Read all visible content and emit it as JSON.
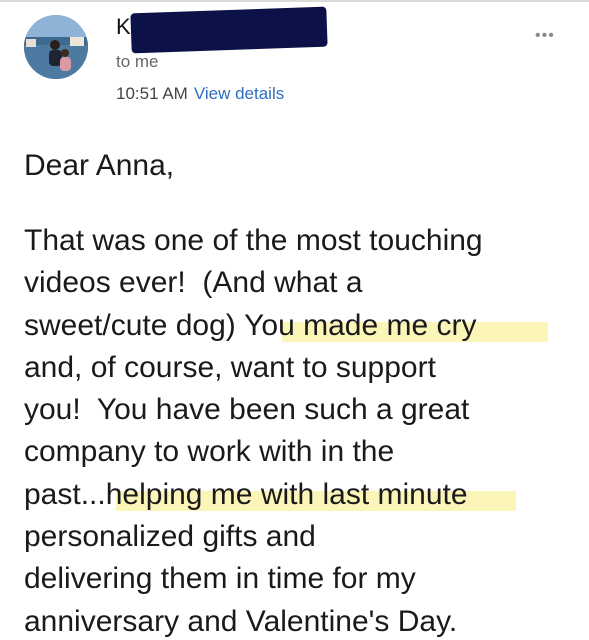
{
  "email": {
    "sender_initial": "K",
    "recipient": "to me",
    "time": "10:51 AM",
    "view_details_label": "View details",
    "more_label": "•••"
  },
  "message": {
    "greeting": "Dear Anna,",
    "lines": [
      "That was one of the most touching",
      "videos ever!  (And what a",
      "sweet/cute dog) ",
      "You made me cry",
      "and, of course, want to support",
      "you!  You have been such a great",
      "company to work with in the",
      "past...",
      "helping me with last minute",
      "personalized gifts and",
      "delivering them in time for my",
      "anniversary and Valentine's Day."
    ]
  },
  "colors": {
    "highlight": "#fbf6b8",
    "link": "#2f6fc0",
    "redaction": "#0c1248"
  }
}
